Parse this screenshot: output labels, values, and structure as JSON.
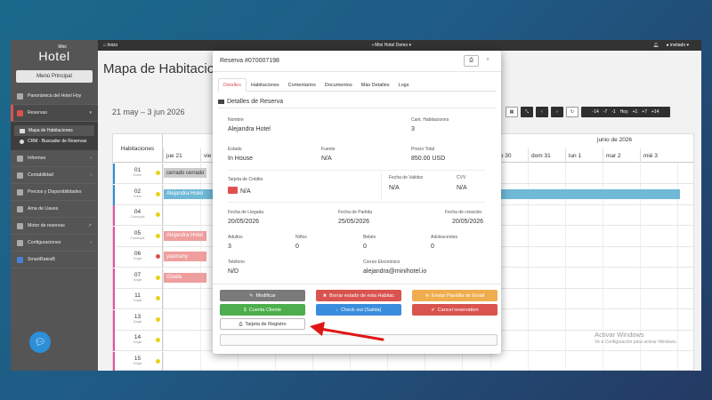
{
  "sidebar": {
    "logo_mini": "Mini",
    "logo_main": "Hotel",
    "menu_button": "Menú Principal",
    "items": [
      {
        "label": "Panorámica del Hotel Hoy",
        "icon": "dashboard-icon"
      },
      {
        "label": "Reservas",
        "icon": "calendar-icon",
        "active": true
      },
      {
        "label": "Informes",
        "icon": "report-icon"
      },
      {
        "label": "Contabilidad",
        "icon": "accounting-icon"
      },
      {
        "label": "Precios y Disponibilidades",
        "icon": "tag-icon"
      },
      {
        "label": "Ama de Llaves",
        "icon": "key-icon"
      },
      {
        "label": "Motor de reservas",
        "icon": "monitor-icon"
      },
      {
        "label": "Configuraciones",
        "icon": "gear-icon"
      },
      {
        "label": "SmartRatesB",
        "icon": "chart-icon"
      }
    ],
    "subitems": [
      "Mapa de Habitaciones",
      "CRM - Buscador de Reservas"
    ]
  },
  "topbar": {
    "home": "Inicio",
    "hotel": "Mini Hotel Demo",
    "user": "invitado"
  },
  "main": {
    "title": "Mapa de Habitaciones",
    "date_range": "21 may – 3 jun 2026",
    "nav": [
      "-14",
      "-7",
      "-1",
      "Hoy",
      "+1",
      "+7",
      "+14"
    ],
    "grid_header": "Habitaciones",
    "month_label": "junio de 2026",
    "days": [
      "jue 21",
      "vie",
      "sáb 30",
      "dom 31",
      "lun 1",
      "mar 2",
      "mié 3"
    ],
    "rooms": [
      {
        "num": "01",
        "type": "Doble",
        "dot": "#e8d21a",
        "color": "#2c8fd8",
        "bar": "cerrado cerrado",
        "bar_color": "#ccc",
        "bar_text": "#333"
      },
      {
        "num": "02",
        "type": "Doble",
        "dot": "#e8d21a",
        "color": "#2c8fd8",
        "bar": "Alejandra Hotel",
        "bar_color": "#6fb8d6",
        "bar_text": "#fff"
      },
      {
        "num": "04",
        "type": "Cuadruple",
        "dot": "#e8d21a",
        "color": "#e84fa1",
        "bar": "",
        "bar_color": "",
        "bar_text": ""
      },
      {
        "num": "05",
        "type": "Cuadruple",
        "dot": "#e8d21a",
        "color": "#e84fa1",
        "bar": "Alejandra Hotel",
        "bar_color": "#ef9e9e",
        "bar_text": "#fff"
      },
      {
        "num": "06",
        "type": "Single",
        "dot": "#d9534f",
        "color": "#e84fa1",
        "bar": "yasmany",
        "bar_color": "#ef9e9e",
        "bar_text": "#fff"
      },
      {
        "num": "07",
        "type": "Single",
        "dot": "#e8d21a",
        "color": "#e84fa1",
        "bar": "Gisela",
        "bar_color": "#ef9e9e",
        "bar_text": "#fff"
      },
      {
        "num": "11",
        "type": "Single",
        "dot": "#e8d21a",
        "color": "#e84fa1",
        "bar": "",
        "bar_color": "",
        "bar_text": ""
      },
      {
        "num": "13",
        "type": "Single",
        "dot": "#e8d21a",
        "color": "#e84fa1",
        "bar": "",
        "bar_color": "",
        "bar_text": ""
      },
      {
        "num": "14",
        "type": "Single",
        "dot": "#e8d21a",
        "color": "#e84fa1",
        "bar": "",
        "bar_color": "",
        "bar_text": ""
      },
      {
        "num": "15",
        "type": "Single",
        "dot": "#e8d21a",
        "color": "#e84fa1",
        "bar": "",
        "bar_color": "",
        "bar_text": ""
      }
    ],
    "watermark_1": "Activar Windows",
    "watermark_2": "Ve a Configuración para activar Windows."
  },
  "modal": {
    "title": "Reserva #070007198",
    "tabs": [
      "Detalles",
      "Habitaciones",
      "Comentarios",
      "Documentos",
      "Más Detalles",
      "Logs"
    ],
    "section": "Detalles de Reserva",
    "fields": {
      "nombre_label": "Nombre",
      "nombre": "Alejandra Hotel",
      "cant_label": "Cant. Habitaciones",
      "cant": "3",
      "estado_label": "Estado",
      "estado": "In House",
      "fuente_label": "Fuente",
      "fuente": "N/A",
      "precio_label": "Precio Total",
      "precio": "850.00 USD",
      "tarjeta_label": "Tarjeta de Crédito",
      "tarjeta": "N/A",
      "validez_label": "Fecha de Validez",
      "validez": "N/A",
      "cvv_label": "CVV",
      "cvv": "N/A",
      "llegada_label": "Fecha de Llegada",
      "llegada": "20/05/2026",
      "partida_label": "Fecha de Partida",
      "partida": "25/05/2026",
      "creacion_label": "Fecha de creación",
      "creacion": "20/05/2026",
      "adultos_label": "Adultos",
      "adultos": "3",
      "ninos_label": "Niños",
      "ninos": "0",
      "bebes_label": "Bebés",
      "bebes": "0",
      "adolescentes_label": "Adolescentes",
      "adolescentes": "0",
      "telefono_label": "Teléfono",
      "telefono": "N/D",
      "email_label": "Correo Electrónico",
      "email": "alejandra@minihotel.io"
    },
    "buttons": {
      "modificar": "Modificar",
      "borrar": "Borrar estado de esta Habitac",
      "enviar": "Enviar Plantilla de Email",
      "cuenta": "Cuenta Cliente",
      "checkout": "Check out (Salida)",
      "cancel": "Cancel reservation",
      "tarjeta_registro": "Tarjeta de Registro"
    },
    "colors": {
      "modificar": "#7a7a7a",
      "borrar": "#d9534f",
      "enviar": "#f0ad4e",
      "cuenta": "#4cae4c",
      "checkout": "#3a8ddc",
      "cancel": "#d9534f"
    }
  },
  "annotation_arrow_color": "#e01515"
}
